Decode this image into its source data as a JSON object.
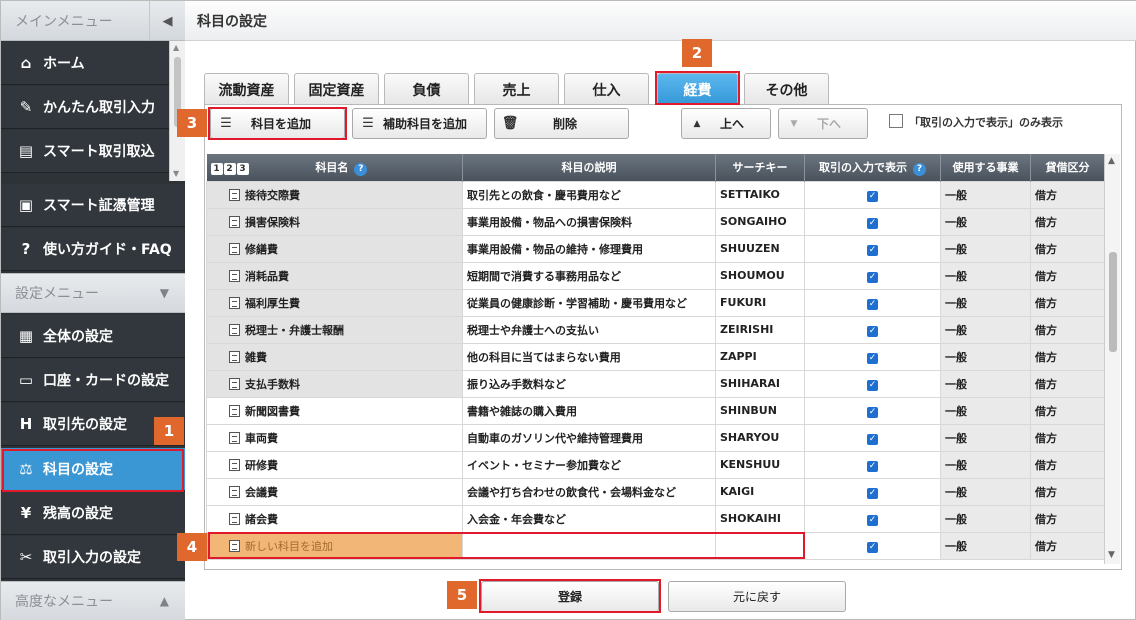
{
  "sidebar": {
    "header": "メインメニュー",
    "items": [
      {
        "label": "ホーム",
        "icon": "home-icon"
      },
      {
        "label": "かんたん取引入力",
        "icon": "pencil-icon"
      },
      {
        "label": "スマート取引取込",
        "icon": "import-icon"
      },
      {
        "label": "スマート証憑管理",
        "icon": "voucher-icon"
      },
      {
        "label": "使い方ガイド・FAQ",
        "icon": "question-icon"
      }
    ],
    "settings_header": "設定メニュー",
    "settings_items": [
      {
        "label": "全体の設定",
        "icon": "settings-doc-icon"
      },
      {
        "label": "口座・カードの設定",
        "icon": "card-icon"
      },
      {
        "label": "取引先の設定",
        "icon": "partner-icon"
      },
      {
        "label": "科目の設定",
        "icon": "account-icon"
      },
      {
        "label": "残高の設定",
        "icon": "yen-icon"
      },
      {
        "label": "取引入力の設定",
        "icon": "wrench-icon"
      }
    ],
    "advanced_header": "高度なメニュー"
  },
  "page_title": "科目の設定",
  "tabs": [
    "流動資産",
    "固定資産",
    "負債",
    "売上",
    "仕入",
    "経費",
    "その他"
  ],
  "active_tab": "経費",
  "toolbar": {
    "add_account": "科目を追加",
    "add_sub_account": "補助科目を追加",
    "delete": "削除",
    "up": "上へ",
    "down": "下へ",
    "filter_label": "「取引の入力で表示」のみ表示"
  },
  "table": {
    "level_nums": [
      "1",
      "2",
      "3"
    ],
    "headers": [
      "科目名",
      "科目の説明",
      "サーチキー",
      "取引の入力で表示",
      "使用する事業",
      "貸借区分"
    ],
    "rows": [
      {
        "name": "接待交際費",
        "desc": "取引先との飲食・慶弔費用など",
        "key": "SETTAIKO",
        "biz": "一般",
        "dc": "借方",
        "white": false
      },
      {
        "name": "損害保険料",
        "desc": "事業用設備・物品への損害保険料",
        "key": "SONGAIHO",
        "biz": "一般",
        "dc": "借方",
        "white": false
      },
      {
        "name": "修繕費",
        "desc": "事業用設備・物品の維持・修理費用",
        "key": "SHUUZEN",
        "biz": "一般",
        "dc": "借方",
        "white": false
      },
      {
        "name": "消耗品費",
        "desc": "短期間で消費する事務用品など",
        "key": "SHOUMOU",
        "biz": "一般",
        "dc": "借方",
        "white": false
      },
      {
        "name": "福利厚生費",
        "desc": "従業員の健康診断・学習補助・慶弔費用など",
        "key": "FUKURI",
        "biz": "一般",
        "dc": "借方",
        "white": false
      },
      {
        "name": "税理士・弁護士報酬",
        "desc": "税理士や弁護士への支払い",
        "key": "ZEIRISHI",
        "biz": "一般",
        "dc": "借方",
        "white": false
      },
      {
        "name": "雑費",
        "desc": "他の科目に当てはまらない費用",
        "key": "ZAPPI",
        "biz": "一般",
        "dc": "借方",
        "white": false
      },
      {
        "name": "支払手数料",
        "desc": "振り込み手数料など",
        "key": "SHIHARAI",
        "biz": "一般",
        "dc": "借方",
        "white": false
      },
      {
        "name": "新聞図書費",
        "desc": "書籍や雑誌の購入費用",
        "key": "SHINBUN",
        "biz": "一般",
        "dc": "借方",
        "white": true
      },
      {
        "name": "車両費",
        "desc": "自動車のガソリン代や維持管理費用",
        "key": "SHARYOU",
        "biz": "一般",
        "dc": "借方",
        "white": true
      },
      {
        "name": "研修費",
        "desc": "イベント・セミナー参加費など",
        "key": "KENSHUU",
        "biz": "一般",
        "dc": "借方",
        "white": true
      },
      {
        "name": "会議費",
        "desc": "会議や打ち合わせの飲食代・会場料金など",
        "key": "KAIGI",
        "biz": "一般",
        "dc": "借方",
        "white": true
      },
      {
        "name": "諸会費",
        "desc": "入会金・年会費など",
        "key": "SHOKAIHI",
        "biz": "一般",
        "dc": "借方",
        "white": true
      }
    ],
    "new_row": {
      "name": "新しい科目を追加",
      "biz": "一般",
      "dc": "借方"
    }
  },
  "footer": {
    "register": "登録",
    "revert": "元に戻す"
  },
  "markers": [
    "1",
    "2",
    "3",
    "4",
    "5"
  ],
  "colors": {
    "accent": "#3b97d3",
    "highlight": "#e01a2a",
    "marker": "#e0682c",
    "new_row": "#f2b776"
  }
}
